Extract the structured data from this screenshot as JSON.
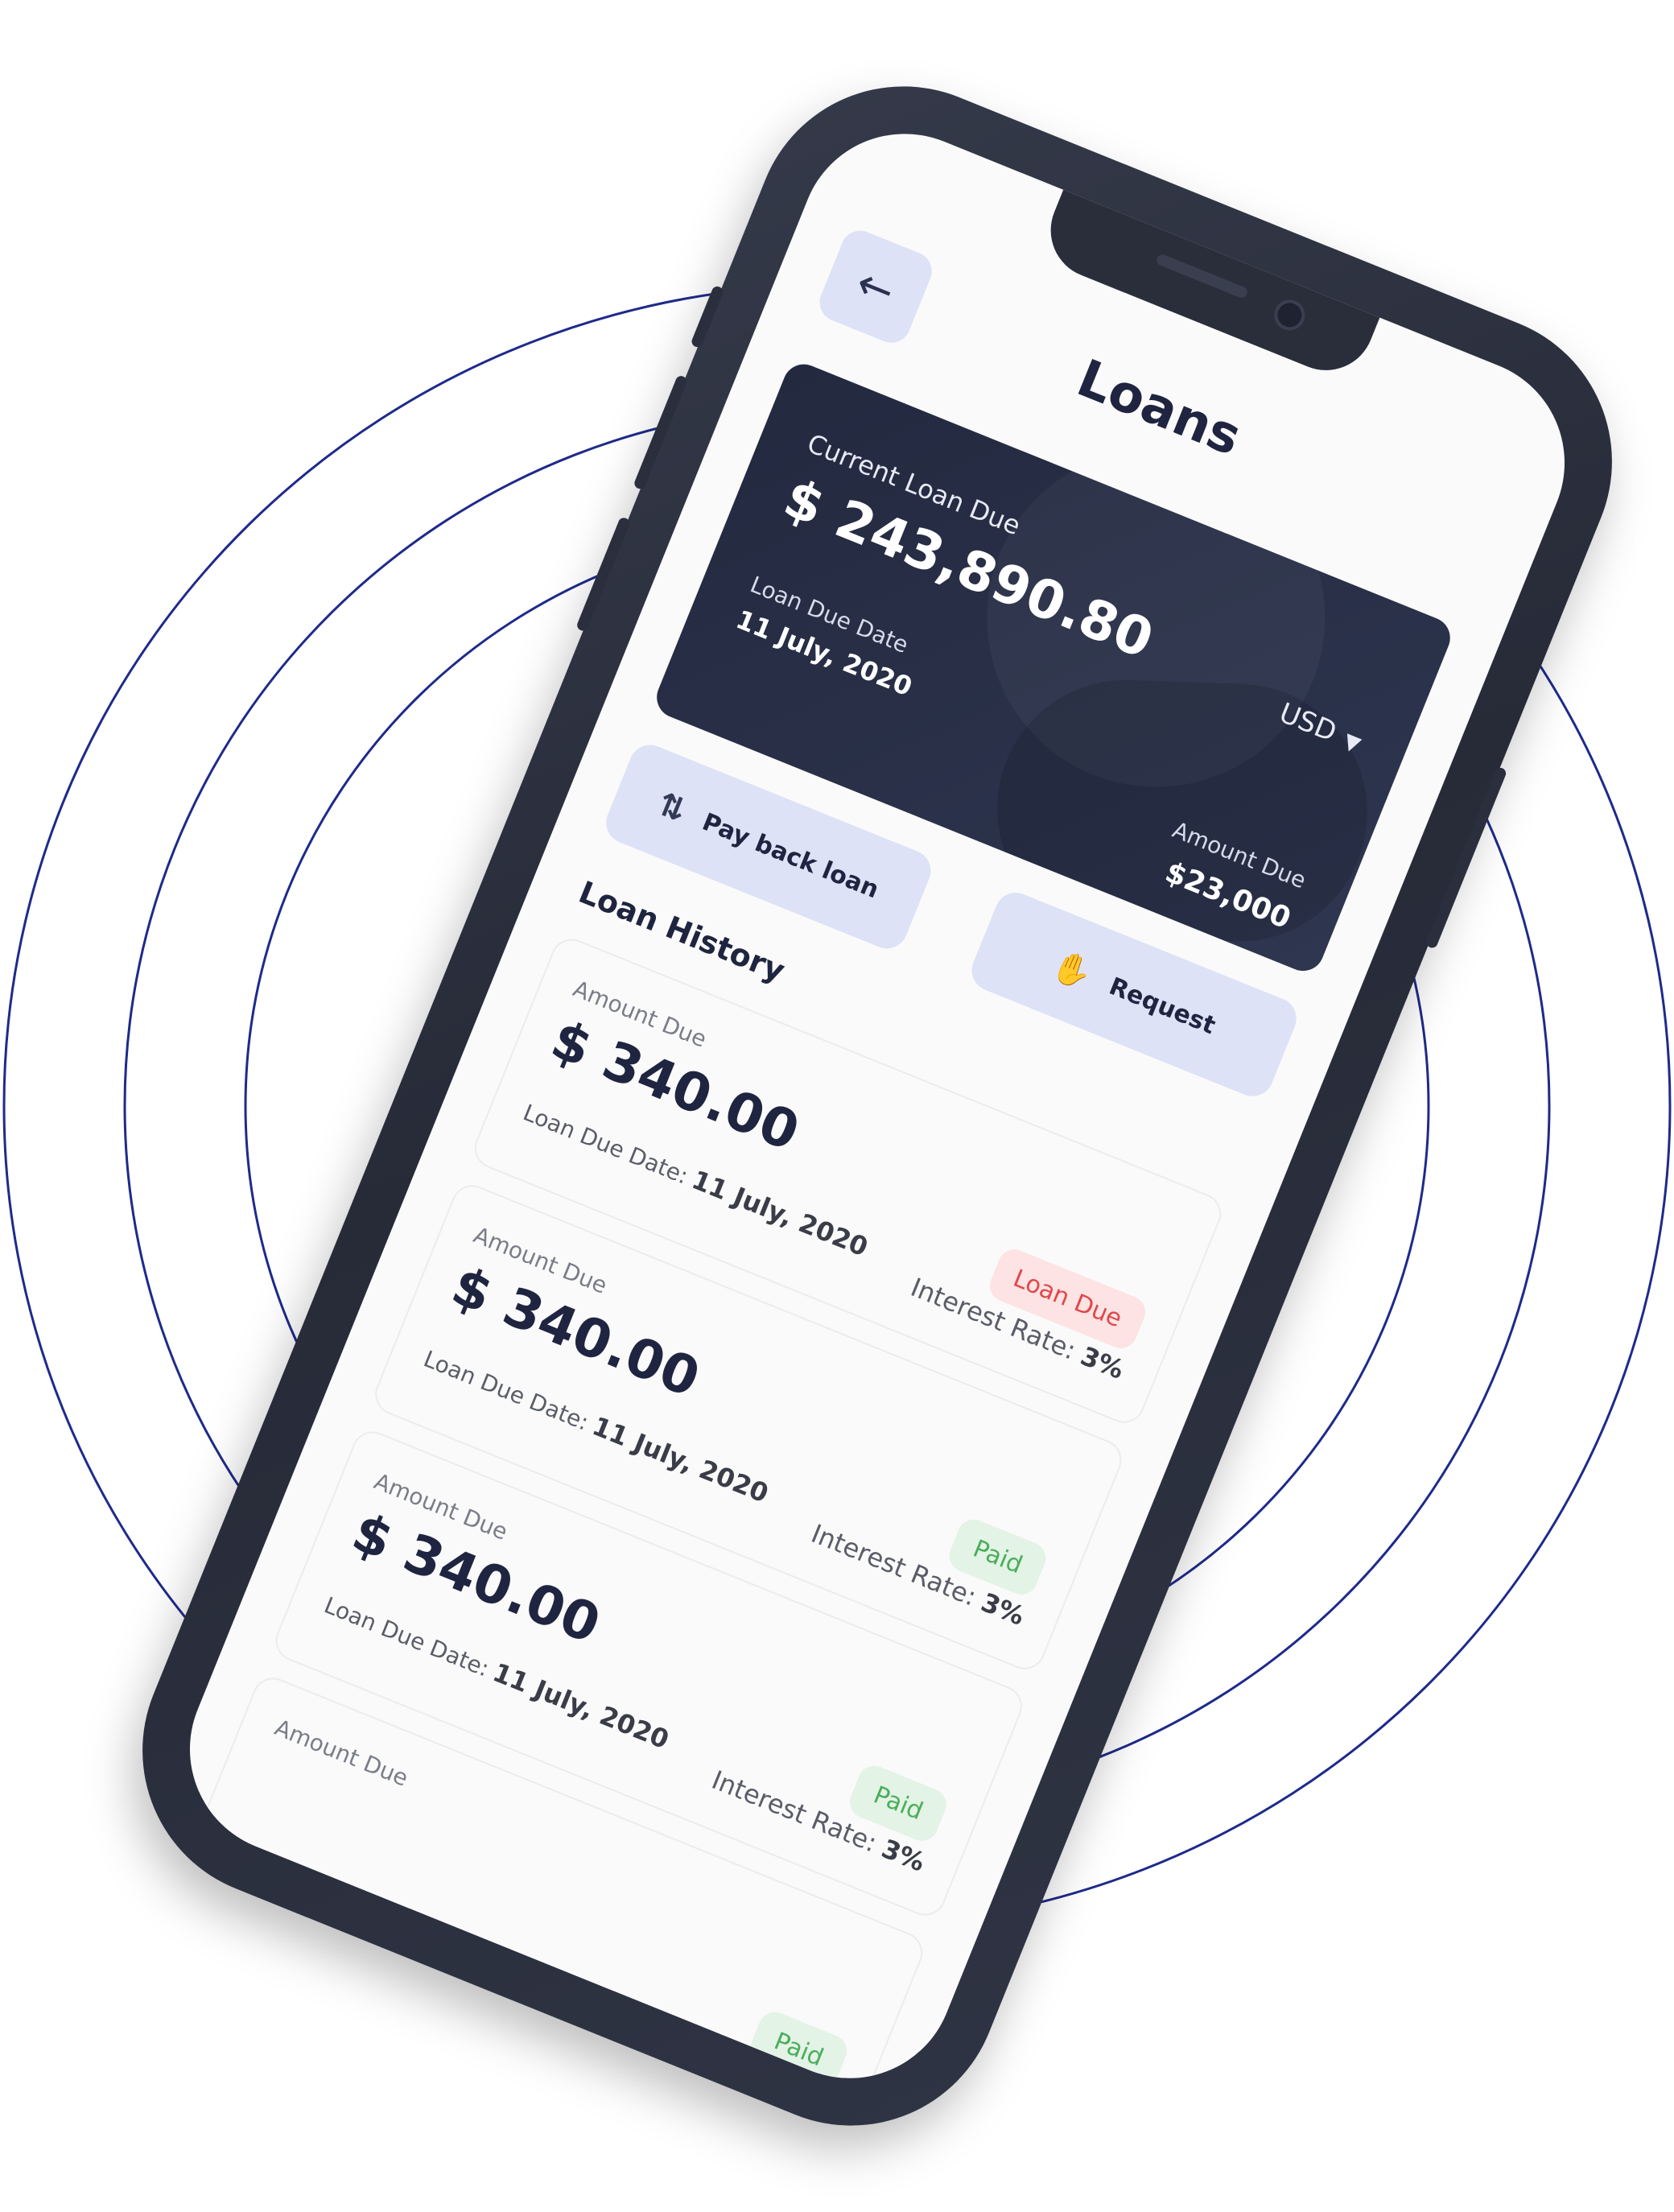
{
  "screen": {
    "title": "Loans"
  },
  "balance_card": {
    "label": "Current Loan Due",
    "amount": "$ 243,890.80",
    "currency": "USD",
    "due_date_label": "Loan Due Date",
    "due_date": "11 July, 2020",
    "amount_due_label": "Amount Due",
    "amount_due": "$23,000"
  },
  "actions": {
    "pay_back_label": "Pay back loan",
    "request_label": "Request"
  },
  "history": {
    "title": "Loan History",
    "items": [
      {
        "amount_label": "Amount Due",
        "amount": "$ 340.00",
        "date_label": "Loan Due Date:",
        "date": "11 July, 2020",
        "status": "Loan Due",
        "rate_label": "Interest Rate:",
        "rate": "3%"
      },
      {
        "amount_label": "Amount Due",
        "amount": "$ 340.00",
        "date_label": "Loan Due Date:",
        "date": "11 July, 2020",
        "status": "Paid",
        "rate_label": "Interest Rate:",
        "rate": "3%"
      },
      {
        "amount_label": "Amount Due",
        "amount": "$ 340.00",
        "date_label": "Loan Due Date:",
        "date": "11 July, 2020",
        "status": "Paid",
        "rate_label": "Interest Rate:",
        "rate": "3%"
      },
      {
        "amount_label": "Amount Due",
        "status": "Paid"
      }
    ]
  },
  "colors": {
    "card_bg": "#272d45",
    "button_bg": "#dde2f6",
    "due_badge": "#e0484b",
    "paid_badge": "#4bae5b",
    "ring": "#1e2a8a"
  }
}
